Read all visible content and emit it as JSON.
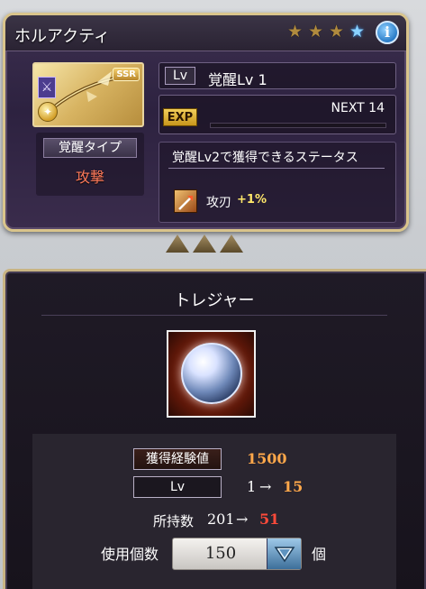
{
  "weapon": {
    "name": "ホルアクティ",
    "rarity_badge": "SSR",
    "stars_total": 4,
    "stars_filled_gold": 3,
    "stars_blue": 1
  },
  "level": {
    "tag": "Lv",
    "text": "覚醒Lv 1"
  },
  "exp": {
    "tag": "EXP",
    "next_text": "NEXT 14",
    "progress": 0
  },
  "awaken_type": {
    "label": "覚醒タイプ",
    "value": "攻撃"
  },
  "status": {
    "title": "覚醒Lv2で獲得できるステータス",
    "item_name": "攻刃",
    "item_bonus": "+1%"
  },
  "treasure": {
    "title": "トレジャー",
    "exp_label": "獲得経験値",
    "exp_value": "1500",
    "lv_label": "Lv",
    "lv_from": "1",
    "lv_arrow": "→",
    "lv_to": "15",
    "held_label": "所持数",
    "held_from": "201",
    "held_arrow": "→",
    "held_to": "51",
    "use_label": "使用個数",
    "use_value": "150",
    "unit": "個"
  },
  "colors": {
    "accent_gold": "#d9c48b",
    "awaken_value": "#ff7a5a",
    "exp_value": "#ffa84a",
    "to_value": "#ff4a3a"
  }
}
